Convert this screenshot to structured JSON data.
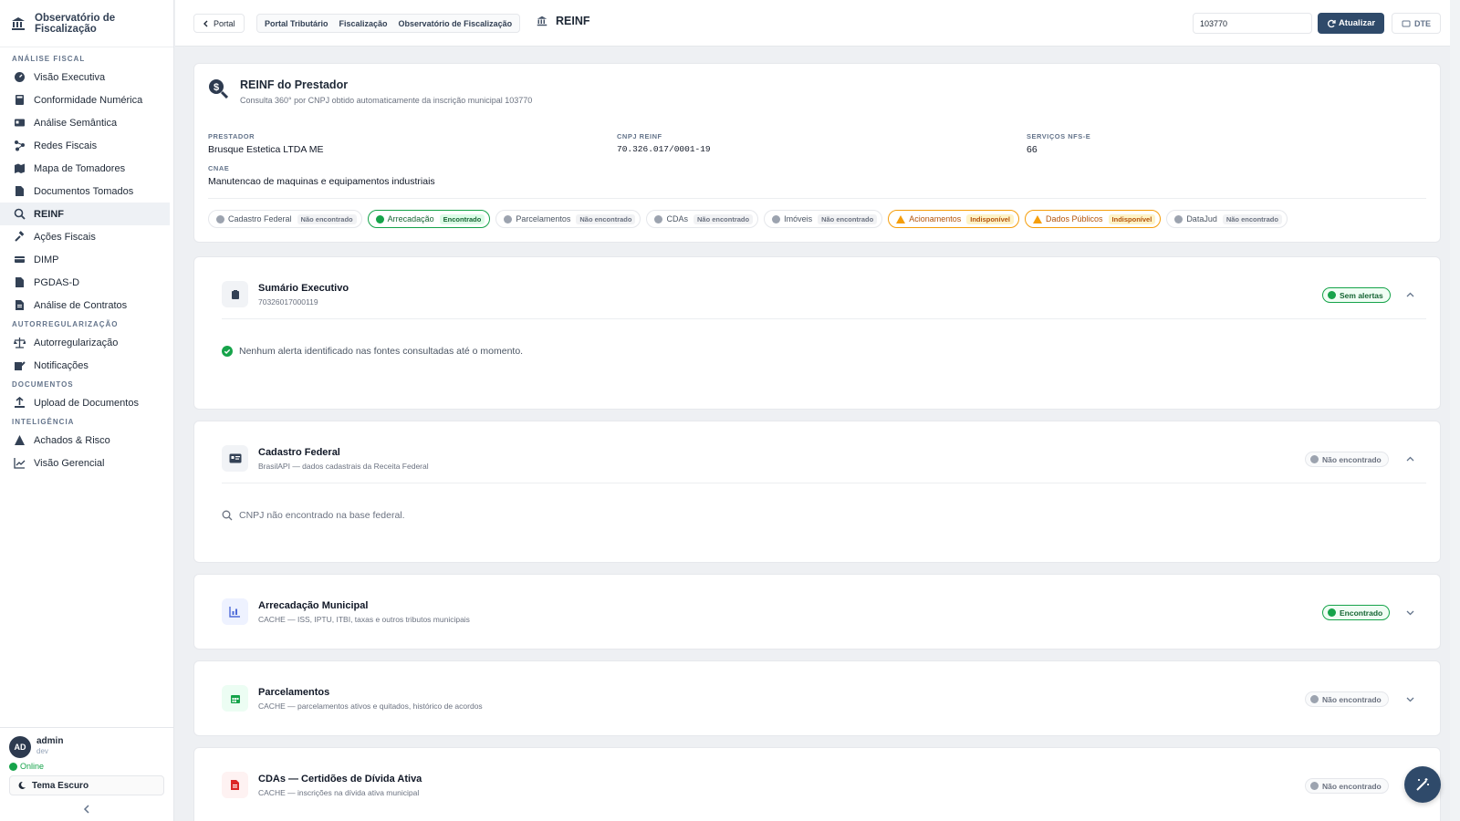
{
  "brand": {
    "title": "Observatório de Fiscalização"
  },
  "sidebar": {
    "sections": [
      {
        "title": "ANÁLISE FISCAL",
        "items": [
          {
            "label": "Visão Executiva",
            "icon": "gauge-icon"
          },
          {
            "label": "Conformidade Numérica",
            "icon": "calculator-icon"
          },
          {
            "label": "Análise Semântica",
            "icon": "id-card-icon"
          },
          {
            "label": "Redes Fiscais",
            "icon": "network-icon"
          },
          {
            "label": "Mapa de Tomadores",
            "icon": "map-icon"
          },
          {
            "label": "Documentos Tomados",
            "icon": "document-icon"
          },
          {
            "label": "REINF",
            "icon": "search-icon",
            "active": true
          },
          {
            "label": "Ações Fiscais",
            "icon": "gavel-icon"
          },
          {
            "label": "DIMP",
            "icon": "card-icon"
          },
          {
            "label": "PGDAS-D",
            "icon": "file-icon"
          },
          {
            "label": "Análise de Contratos",
            "icon": "contract-icon"
          }
        ]
      },
      {
        "title": "AUTORREGULARIZAÇÃO",
        "items": [
          {
            "label": "Autorregularização",
            "icon": "scale-icon"
          },
          {
            "label": "Notificações",
            "icon": "edit-icon"
          }
        ]
      },
      {
        "title": "DOCUMENTOS",
        "items": [
          {
            "label": "Upload de Documentos",
            "icon": "upload-icon"
          }
        ]
      },
      {
        "title": "INTELIGÊNCIA",
        "items": [
          {
            "label": "Achados & Risco",
            "icon": "warning-icon"
          },
          {
            "label": "Visão Gerencial",
            "icon": "chart-line-icon"
          }
        ]
      }
    ]
  },
  "user": {
    "initials": "AD",
    "name": "admin",
    "role": "dev",
    "status": "Online",
    "theme_label": "Tema Escuro"
  },
  "topbar": {
    "portal_label": "Portal",
    "breadcrumb": [
      "Portal Tributário",
      "Fiscalização",
      "Observatório de Fiscalização"
    ],
    "page_title": "REINF",
    "search_value": "103770",
    "update_label": "Atualizar",
    "dte_label": "DTE"
  },
  "hero": {
    "title": "REINF do Prestador",
    "subtitle": "Consulta 360° por CNPJ obtido automaticamente da inscrição municipal 103770",
    "fields": {
      "prestador_label": "PRESTADOR",
      "prestador_value": "Brusque Estetica LTDA ME",
      "cnpj_label": "CNPJ REINF",
      "cnpj_value": "70.326.017/0001-19",
      "servicos_label": "SERVIÇOS NFS-E",
      "servicos_value": "66",
      "cnae_label": "CNAE",
      "cnae_value": "Manutencao de maquinas e equipamentos industriais"
    },
    "chips": [
      {
        "label": "Cadastro Federal",
        "status": "Não encontrado",
        "kind": "grey"
      },
      {
        "label": "Arrecadação",
        "status": "Encontrado",
        "kind": "ok"
      },
      {
        "label": "Parcelamentos",
        "status": "Não encontrado",
        "kind": "grey"
      },
      {
        "label": "CDAs",
        "status": "Não encontrado",
        "kind": "grey"
      },
      {
        "label": "Imóveis",
        "status": "Não encontrado",
        "kind": "grey"
      },
      {
        "label": "Acionamentos",
        "status": "Indisponível",
        "kind": "warn"
      },
      {
        "label": "Dados Públicos",
        "status": "Indisponível",
        "kind": "warn"
      },
      {
        "label": "DataJud",
        "status": "Não encontrado",
        "kind": "grey"
      }
    ]
  },
  "sections": {
    "sumario": {
      "title": "Sumário Executivo",
      "subtitle": "70326017000119",
      "badge": "Sem alertas",
      "message": "Nenhum alerta identificado nas fontes consultadas até o momento."
    },
    "cadastro": {
      "title": "Cadastro Federal",
      "subtitle": "BrasilAPI — dados cadastrais da Receita Federal",
      "badge": "Não encontrado",
      "message": "CNPJ não encontrado na base federal."
    },
    "arrecadacao": {
      "title": "Arrecadação Municipal",
      "subtitle": "CACHE — ISS, IPTU, ITBI, taxas e outros tributos municipais",
      "badge": "Encontrado"
    },
    "parcelamentos": {
      "title": "Parcelamentos",
      "subtitle": "CACHE — parcelamentos ativos e quitados, histórico de acordos",
      "badge": "Não encontrado"
    },
    "cdas": {
      "title": "CDAs — Certidões de Dívida Ativa",
      "subtitle": "CACHE — inscrições na dívida ativa municipal",
      "badge": "Não encontrado"
    }
  },
  "colors": {
    "primary": "#2f4a6a",
    "success": "#16a34a",
    "warning": "#f59e0b",
    "neutral": "#9ca3af"
  }
}
